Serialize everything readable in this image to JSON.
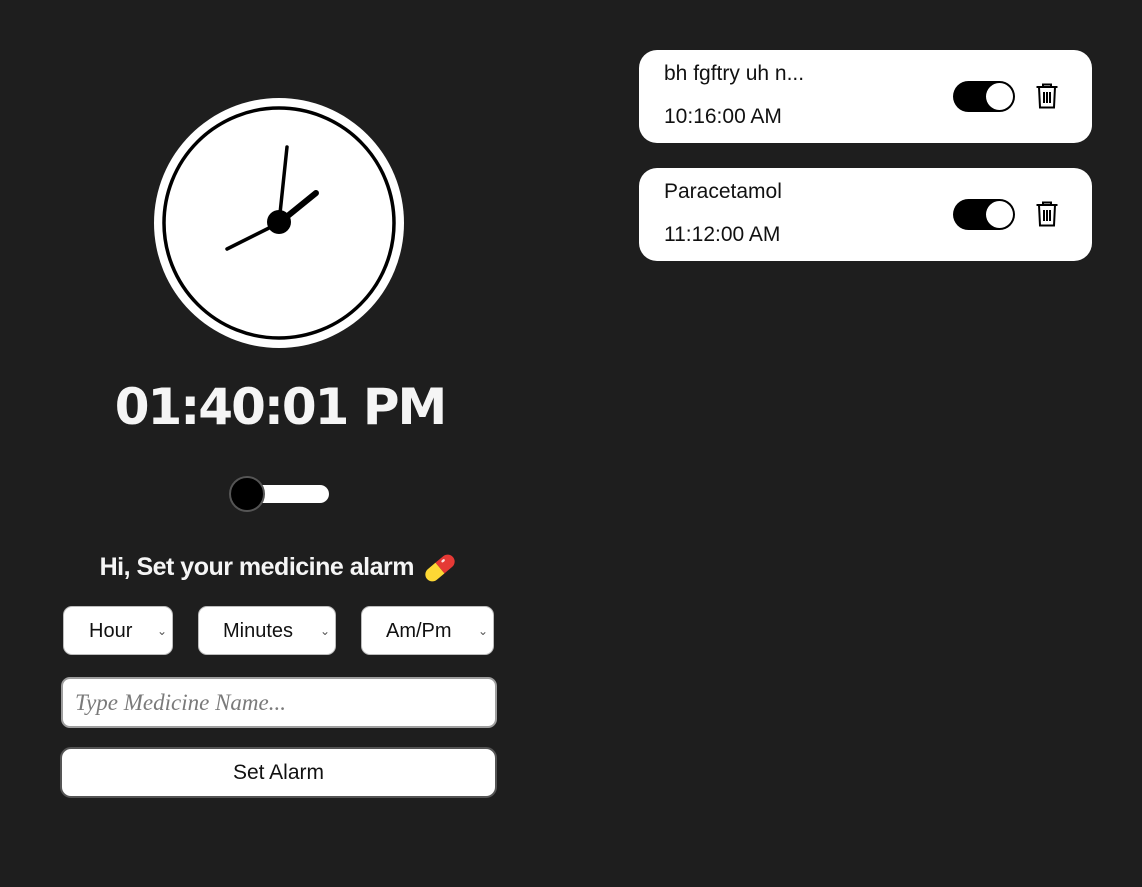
{
  "clock": {
    "digital_time": "01:40:01 PM",
    "analog": {
      "hour": 13,
      "minute": 40,
      "second": 1
    }
  },
  "theme_toggle": {
    "state": "off"
  },
  "greeting": {
    "text": "Hi, Set your medicine alarm",
    "icon": "pill-icon"
  },
  "form": {
    "hour_select": {
      "selected": "Hour"
    },
    "minutes_select": {
      "selected": "Minutes"
    },
    "ampm_select": {
      "selected": "Am/Pm"
    },
    "medicine_input": {
      "placeholder": "Type Medicine Name...",
      "value": ""
    },
    "set_alarm_label": "Set Alarm"
  },
  "alarms": [
    {
      "name": "bh fgftry uh n...",
      "time": "10:16:00 AM",
      "enabled": true
    },
    {
      "name": "Paracetamol",
      "time": "11:12:00 AM",
      "enabled": true
    }
  ],
  "colors": {
    "background": "#1e1e1e",
    "card": "#ffffff",
    "text_light": "#f5f5f5",
    "pill_red": "#e53935",
    "pill_yellow": "#fdd835"
  }
}
